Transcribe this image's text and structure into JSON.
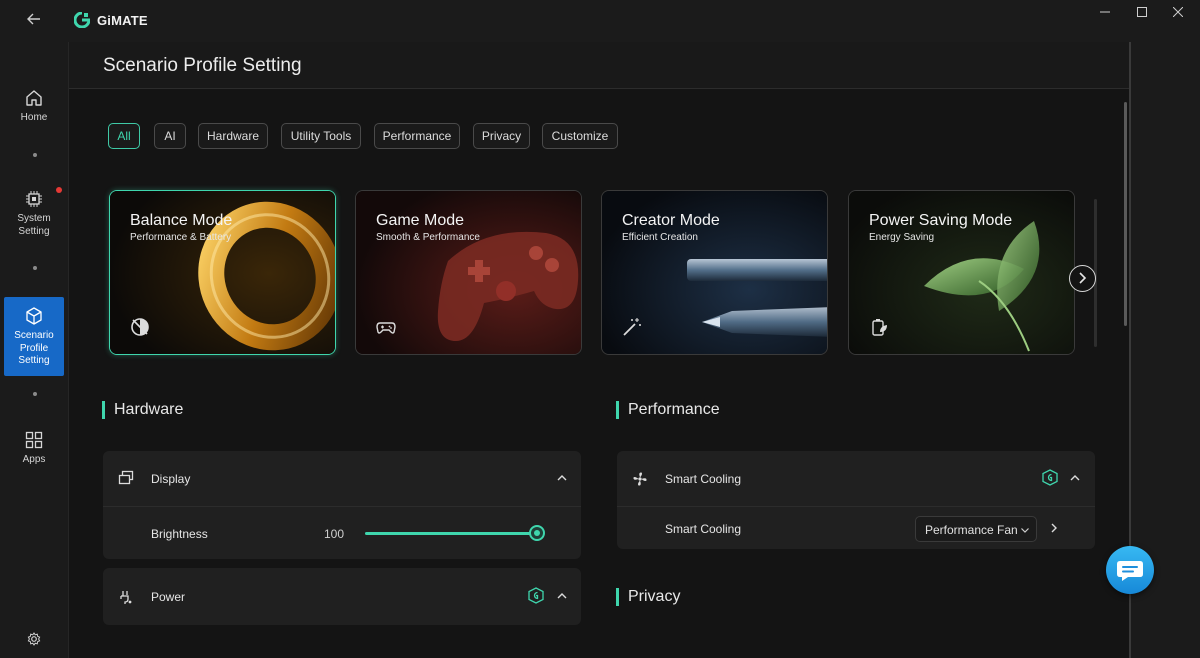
{
  "app": {
    "name": "GiMATE",
    "window_controls": [
      "minimize",
      "maximize",
      "close"
    ]
  },
  "sidebar": {
    "items": [
      {
        "label": "Home",
        "icon": "home-icon"
      },
      {
        "label": "System\nSetting",
        "icon": "chip-icon",
        "notification": true
      },
      {
        "label": "Scenario\nProfile\nSetting",
        "icon": "cube-icon",
        "active": true
      },
      {
        "label": "Apps",
        "icon": "apps-grid-icon"
      }
    ],
    "settings_icon": "gear-icon"
  },
  "page": {
    "title": "Scenario Profile Setting"
  },
  "filters": {
    "items": [
      "All",
      "AI",
      "Hardware",
      "Utility Tools",
      "Performance",
      "Privacy",
      "Customize"
    ],
    "selected": "All"
  },
  "modes": [
    {
      "title": "Balance Mode",
      "subtitle": "Performance & Battery",
      "icon": "balance-icon",
      "active": true
    },
    {
      "title": "Game Mode",
      "subtitle": "Smooth & Performance",
      "icon": "gamepad-icon"
    },
    {
      "title": "Creator Mode",
      "subtitle": "Efficient Creation",
      "icon": "magic-wand-icon"
    },
    {
      "title": "Power Saving Mode",
      "subtitle": "Energy Saving",
      "icon": "battery-leaf-icon"
    }
  ],
  "hardware": {
    "title": "Hardware",
    "display": {
      "label": "Display",
      "brightness_label": "Brightness",
      "brightness_value": "100",
      "brightness_level": 1.0
    },
    "power": {
      "label": "Power"
    }
  },
  "performance": {
    "title": "Performance",
    "smart_cooling": {
      "label": "Smart Cooling",
      "row_label": "Smart Cooling",
      "selected_option": "Performance Fan"
    }
  },
  "privacy": {
    "title": "Privacy"
  },
  "colors": {
    "accent": "#3fd6ad",
    "sidebar_active": "#1769c7",
    "chat_button": "#1f9be3"
  }
}
